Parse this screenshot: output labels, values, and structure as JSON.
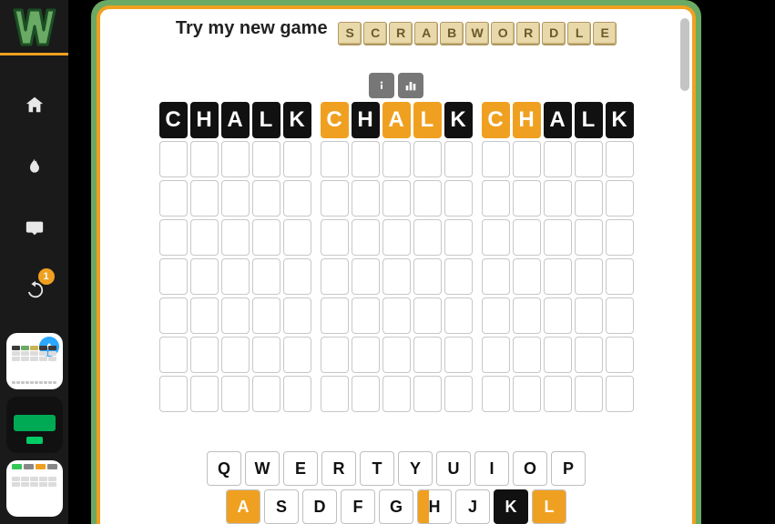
{
  "sidebar": {
    "notification_count": "1"
  },
  "promo": {
    "lead_text": "Try my new game",
    "tiles": [
      "S",
      "C",
      "R",
      "A",
      "B",
      "W",
      "O",
      "R",
      "D",
      "L",
      "E"
    ]
  },
  "boards": [
    {
      "guess": [
        "C",
        "H",
        "A",
        "L",
        "K"
      ],
      "states": [
        "absent",
        "absent",
        "absent",
        "absent",
        "absent"
      ]
    },
    {
      "guess": [
        "C",
        "H",
        "A",
        "L",
        "K"
      ],
      "states": [
        "present",
        "absent",
        "present",
        "present",
        "absent"
      ]
    },
    {
      "guess": [
        "C",
        "H",
        "A",
        "L",
        "K"
      ],
      "states": [
        "present",
        "present",
        "absent",
        "absent",
        "absent"
      ]
    }
  ],
  "keyboard": {
    "row1": [
      {
        "k": "Q"
      },
      {
        "k": "W"
      },
      {
        "k": "E"
      },
      {
        "k": "R"
      },
      {
        "k": "T"
      },
      {
        "k": "Y"
      },
      {
        "k": "U"
      },
      {
        "k": "I"
      },
      {
        "k": "O"
      },
      {
        "k": "P"
      }
    ],
    "row2": [
      {
        "k": "A",
        "hint": "orange",
        "full": true
      },
      {
        "k": "S"
      },
      {
        "k": "D"
      },
      {
        "k": "F"
      },
      {
        "k": "G"
      },
      {
        "k": "H",
        "hint": "orange"
      },
      {
        "k": "J"
      },
      {
        "k": "K",
        "black": true
      },
      {
        "k": "L",
        "hint": "orange",
        "full": true
      }
    ]
  }
}
